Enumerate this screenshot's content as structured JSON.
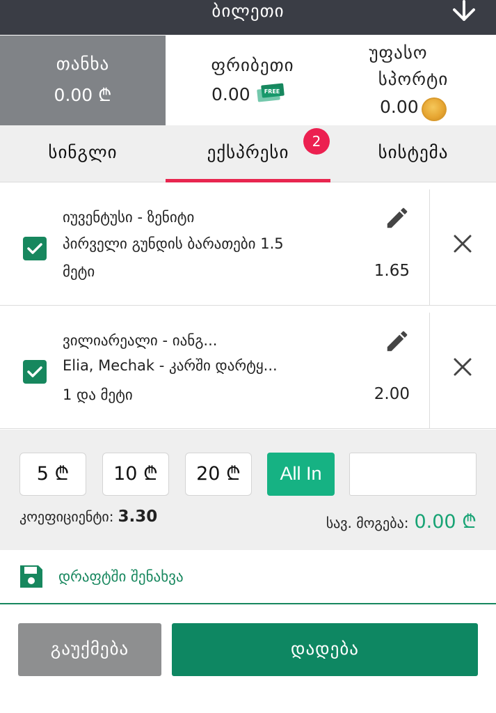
{
  "header": {
    "title": "ბილეთი",
    "collapse_icon": "arrow-down-icon"
  },
  "balances": {
    "cash": {
      "label": "თანხა",
      "value": "0.00 ₾"
    },
    "freebet": {
      "label": "ფრიბეთი",
      "value": "0.00",
      "ticket_text": "FREE"
    },
    "sport": {
      "label_line1": "უფასო",
      "label_line2": "სპორტი",
      "value": "0.00"
    }
  },
  "tabs": [
    {
      "label": "სინგლი"
    },
    {
      "label": "ექსპრესი",
      "badge": "2"
    },
    {
      "label": "სისტემა"
    }
  ],
  "bets": [
    {
      "match": "იუვენტუსი - ზენიტი",
      "market": "პირველი გუნდის ბარათები 1.5",
      "selection": "მეტი",
      "odds": "1.65"
    },
    {
      "match": "ვილიარეალი - იანგ...",
      "market": "Elia, Mechak - კარში დარტყ...",
      "selection": "1 და მეტი",
      "odds": "2.00"
    }
  ],
  "stake": {
    "quick": [
      "5 ₾",
      "10 ₾",
      "20 ₾"
    ],
    "allin": "All In",
    "amount_value": "",
    "coef_label": "კოეფიციენტი:",
    "coef_value": "3.30",
    "win_label": "სავ. მოგება:",
    "win_value": "0.00 ₾"
  },
  "draft": {
    "label": "დრაფტში შენახვა"
  },
  "actions": {
    "cancel": "გაუქმება",
    "place": "დადება"
  },
  "colors": {
    "accent_green": "#17875e",
    "allin_green": "#16b283",
    "tab_underline": "#e8264f",
    "header_bg": "#3a3d45"
  }
}
